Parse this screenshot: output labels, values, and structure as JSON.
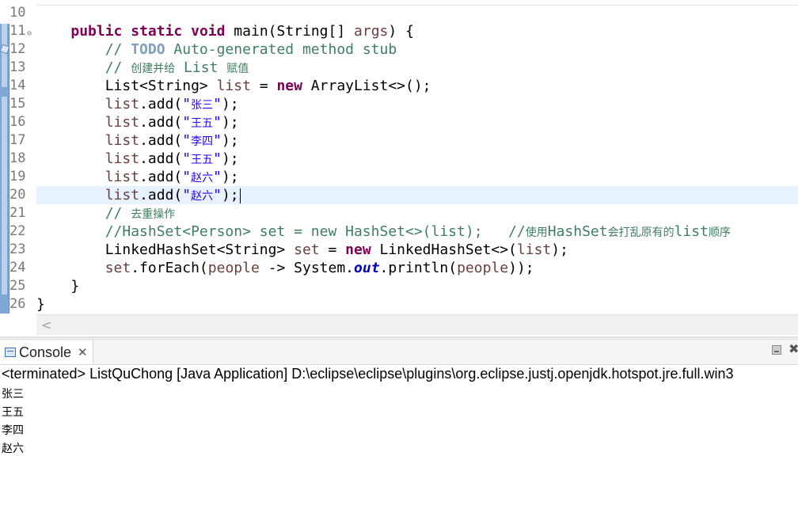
{
  "editor": {
    "lines": [
      {
        "num": "10",
        "tokens": []
      },
      {
        "num": "11",
        "fold": "⊖",
        "tokens": [
          {
            "t": "    ",
            "c": ""
          },
          {
            "t": "public",
            "c": "kw"
          },
          {
            "t": " ",
            "c": ""
          },
          {
            "t": "static",
            "c": "kw"
          },
          {
            "t": " ",
            "c": ""
          },
          {
            "t": "void",
            "c": "kw"
          },
          {
            "t": " main(String[] ",
            "c": ""
          },
          {
            "t": "args",
            "c": "var"
          },
          {
            "t": ") {",
            "c": ""
          }
        ]
      },
      {
        "num": "12",
        "tokens": [
          {
            "t": "        ",
            "c": ""
          },
          {
            "t": "// ",
            "c": "cm"
          },
          {
            "t": "TODO",
            "c": "todo"
          },
          {
            "t": " Auto-generated method stub",
            "c": "cm"
          }
        ]
      },
      {
        "num": "13",
        "tokens": [
          {
            "t": "        ",
            "c": ""
          },
          {
            "t": "// ",
            "c": "cm"
          },
          {
            "t": "创建并给",
            "c": "cm cjk"
          },
          {
            "t": " List ",
            "c": "cm"
          },
          {
            "t": "赋值",
            "c": "cm cjk"
          }
        ]
      },
      {
        "num": "14",
        "tokens": [
          {
            "t": "        List<String> ",
            "c": ""
          },
          {
            "t": "list",
            "c": "var"
          },
          {
            "t": " = ",
            "c": ""
          },
          {
            "t": "new",
            "c": "kw"
          },
          {
            "t": " ArrayList<>();",
            "c": ""
          }
        ]
      },
      {
        "num": "15",
        "tokens": [
          {
            "t": "        ",
            "c": ""
          },
          {
            "t": "list",
            "c": "var"
          },
          {
            "t": ".add(",
            "c": ""
          },
          {
            "t": "\"",
            "c": "str"
          },
          {
            "t": "张三",
            "c": "str cjk"
          },
          {
            "t": "\"",
            "c": "str"
          },
          {
            "t": ");",
            "c": ""
          }
        ]
      },
      {
        "num": "16",
        "tokens": [
          {
            "t": "        ",
            "c": ""
          },
          {
            "t": "list",
            "c": "var"
          },
          {
            "t": ".add(",
            "c": ""
          },
          {
            "t": "\"",
            "c": "str"
          },
          {
            "t": "王五",
            "c": "str cjk"
          },
          {
            "t": "\"",
            "c": "str"
          },
          {
            "t": ");",
            "c": ""
          }
        ]
      },
      {
        "num": "17",
        "tokens": [
          {
            "t": "        ",
            "c": ""
          },
          {
            "t": "list",
            "c": "var"
          },
          {
            "t": ".add(",
            "c": ""
          },
          {
            "t": "\"",
            "c": "str"
          },
          {
            "t": "李四",
            "c": "str cjk"
          },
          {
            "t": "\"",
            "c": "str"
          },
          {
            "t": ");",
            "c": ""
          }
        ]
      },
      {
        "num": "18",
        "tokens": [
          {
            "t": "        ",
            "c": ""
          },
          {
            "t": "list",
            "c": "var"
          },
          {
            "t": ".add(",
            "c": ""
          },
          {
            "t": "\"",
            "c": "str"
          },
          {
            "t": "王五",
            "c": "str cjk"
          },
          {
            "t": "\"",
            "c": "str"
          },
          {
            "t": ");",
            "c": ""
          }
        ]
      },
      {
        "num": "19",
        "tokens": [
          {
            "t": "        ",
            "c": ""
          },
          {
            "t": "list",
            "c": "var"
          },
          {
            "t": ".add(",
            "c": ""
          },
          {
            "t": "\"",
            "c": "str"
          },
          {
            "t": "赵六",
            "c": "str cjk"
          },
          {
            "t": "\"",
            "c": "str"
          },
          {
            "t": ");",
            "c": ""
          }
        ]
      },
      {
        "num": "20",
        "current": true,
        "tokens": [
          {
            "t": "        ",
            "c": ""
          },
          {
            "t": "list",
            "c": "var"
          },
          {
            "t": ".add(",
            "c": ""
          },
          {
            "t": "\"",
            "c": "str"
          },
          {
            "t": "赵六",
            "c": "str cjk"
          },
          {
            "t": "\"",
            "c": "str"
          },
          {
            "t": ");",
            "c": ""
          }
        ]
      },
      {
        "num": "21",
        "tokens": [
          {
            "t": "        ",
            "c": ""
          },
          {
            "t": "// ",
            "c": "cm"
          },
          {
            "t": "去重操作",
            "c": "cm cjk"
          }
        ]
      },
      {
        "num": "22",
        "tokens": [
          {
            "t": "        ",
            "c": ""
          },
          {
            "t": "//HashSet<Person> set = new HashSet<>(list);   //",
            "c": "cm"
          },
          {
            "t": "使用",
            "c": "cm cjk"
          },
          {
            "t": "HashSet",
            "c": "cm"
          },
          {
            "t": "会打乱原有的",
            "c": "cm cjk"
          },
          {
            "t": "list",
            "c": "cm"
          },
          {
            "t": "顺序",
            "c": "cm cjk"
          }
        ]
      },
      {
        "num": "23",
        "tokens": [
          {
            "t": "        LinkedHashSet<String> ",
            "c": ""
          },
          {
            "t": "set",
            "c": "var"
          },
          {
            "t": " = ",
            "c": ""
          },
          {
            "t": "new",
            "c": "kw"
          },
          {
            "t": " LinkedHashSet<>(",
            "c": ""
          },
          {
            "t": "list",
            "c": "var"
          },
          {
            "t": ");",
            "c": ""
          }
        ]
      },
      {
        "num": "24",
        "tokens": [
          {
            "t": "        ",
            "c": ""
          },
          {
            "t": "set",
            "c": "var"
          },
          {
            "t": ".forEach(",
            "c": ""
          },
          {
            "t": "people",
            "c": "var"
          },
          {
            "t": " -> System.",
            "c": ""
          },
          {
            "t": "out",
            "c": "fld"
          },
          {
            "t": ".println(",
            "c": ""
          },
          {
            "t": "people",
            "c": "var"
          },
          {
            "t": "));",
            "c": ""
          }
        ]
      },
      {
        "num": "25",
        "tokens": [
          {
            "t": "    }",
            "c": ""
          }
        ]
      },
      {
        "num": "26",
        "tokens": [
          {
            "t": "}",
            "c": ""
          }
        ]
      }
    ],
    "scroll_arrow": "<"
  },
  "console": {
    "tab_label": "Console",
    "close_glyph": "✕",
    "close_view_glyph": "✖",
    "status": "<terminated> ListQuChong [Java Application] D:\\eclipse\\eclipse\\plugins\\org.eclipse.justj.openjdk.hotspot.jre.full.win3",
    "output": [
      "张三",
      "王五",
      "李四",
      "赵六"
    ]
  },
  "colors": {
    "keyword": "#7f0055",
    "comment": "#3f7f5f",
    "string": "#2a00ff",
    "variable": "#6a3e3e",
    "current_line": "#e8f2fe"
  }
}
